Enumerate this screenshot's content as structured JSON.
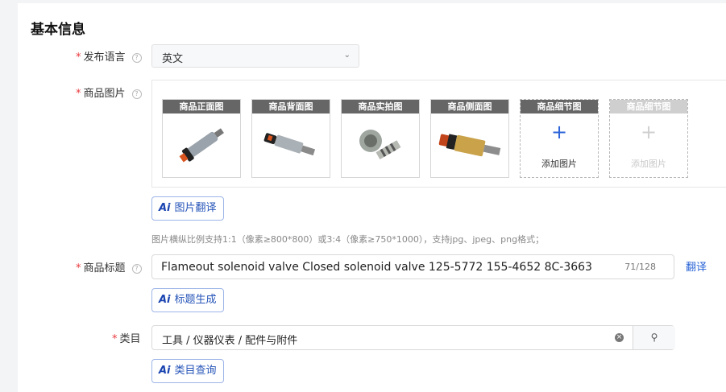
{
  "section": {
    "title": "基本信息"
  },
  "language": {
    "label": "发布语言",
    "value": "英文"
  },
  "images": {
    "label": "商品图片",
    "items": [
      {
        "caption": "商品正面图"
      },
      {
        "caption": "商品背面图"
      },
      {
        "caption": "商品实拍图"
      },
      {
        "caption": "商品侧面图"
      }
    ],
    "add_slots": [
      {
        "caption": "商品细节图",
        "add_label": "添加图片"
      },
      {
        "caption": "商品细节图",
        "add_label": "添加图片"
      }
    ],
    "translate_button": "图片翻译",
    "hint": "图片横纵比例支持1:1（像素≥800*800）或3:4（像素≥750*1000），支持jpg、jpeg、png格式；"
  },
  "product_title": {
    "label": "商品标题",
    "value": "Flameout solenoid valve Closed solenoid valve 125-5772 155-4652 8C-3663",
    "count": "71/128",
    "translate_link": "翻译",
    "generate_button": "标题生成"
  },
  "category": {
    "label": "类目",
    "value": "工具 / 仪器仪表 / 配件与附件",
    "query_button": "类目查询"
  },
  "ai_badge": "Ai",
  "colors": {
    "accent": "#2a64d6",
    "required": "#e8383d"
  }
}
